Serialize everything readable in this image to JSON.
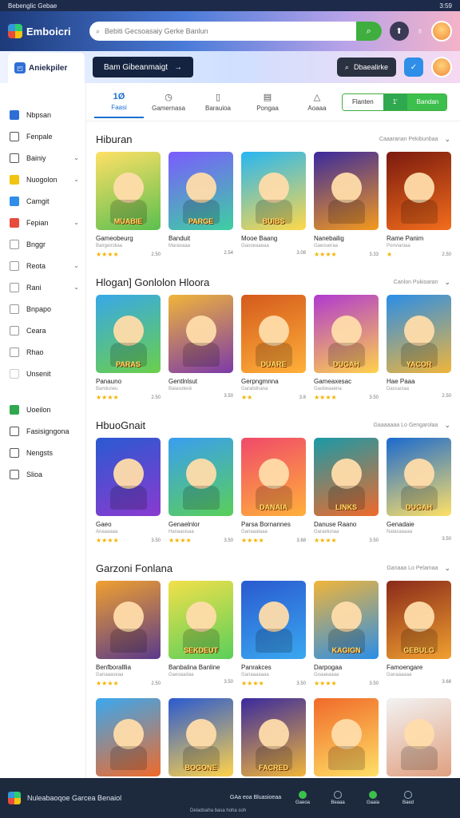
{
  "status": {
    "left": "Bebenglic Gebae",
    "right": "3:59"
  },
  "header": {
    "logo": "Emboicri",
    "search_placeholder": "Bebiti Gecsoasaiy Gerke Banlun"
  },
  "subbar": {
    "brand": "Aniekpiler",
    "promo": "Bam Gibeanmaigt",
    "btn": "Dbaealirke"
  },
  "sidebar": {
    "items": [
      {
        "label": "Nbpsan",
        "icon": "menu-icon",
        "color": "#2e6fd6"
      },
      {
        "label": "Fenpale",
        "icon": "home-icon",
        "color": "#555"
      },
      {
        "label": "Bainiy",
        "icon": "calendar-icon",
        "color": "#555",
        "chev": "⌄"
      },
      {
        "label": "Nuogolon",
        "icon": "coin-icon",
        "color": "#f1c40f",
        "chev": "⌄"
      },
      {
        "label": "Camgit",
        "icon": "chat-icon",
        "color": "#2e8ee8"
      },
      {
        "label": "Fepian",
        "icon": "game-icon",
        "color": "#e74c3c",
        "chev": "⌄"
      },
      {
        "label": "Bnggr",
        "icon": "box-icon",
        "color": "#999"
      },
      {
        "label": "Reota",
        "icon": "gear-icon",
        "color": "#999",
        "chev": "⌄"
      },
      {
        "label": "Rani",
        "icon": "tag-icon",
        "color": "#999",
        "chev": "⌄"
      },
      {
        "label": "Bnpapo",
        "icon": "grid-icon",
        "color": "#999"
      },
      {
        "label": "Ceara",
        "icon": "star-icon",
        "color": "#999"
      },
      {
        "label": "Rhao",
        "icon": "clock-icon",
        "color": "#999"
      },
      {
        "label": "Unsenit",
        "icon": "dot-icon",
        "color": "#fff"
      }
    ],
    "items2": [
      {
        "label": "Uoeilon",
        "icon": "clover-icon",
        "color": "#2fa84f"
      },
      {
        "label": "Fasisigngona",
        "icon": "cart-icon",
        "color": "#555"
      },
      {
        "label": "Nengsts",
        "icon": "bag-icon",
        "color": "#555"
      },
      {
        "label": "Slioa",
        "icon": "help-icon",
        "color": "#555"
      }
    ]
  },
  "tabs": [
    {
      "icon": "1Ø",
      "label": "Faasi"
    },
    {
      "icon": "◷",
      "label": "Gamernasa"
    },
    {
      "icon": "▯",
      "label": "Barauioa"
    },
    {
      "icon": "▤",
      "label": "Pongaa"
    },
    {
      "icon": "△",
      "label": "Aoaaa"
    }
  ],
  "filters": [
    "Flanten",
    "1'",
    "Bandan"
  ],
  "sections": [
    {
      "title": "Hiburan",
      "more": "Caaaranan Pekibunbaa",
      "cards": [
        {
          "name": "Gameobeurg",
          "sub": "Bairgeicdiaa",
          "stars": "★★★★",
          "score": "2.50",
          "bg": "linear-gradient(160deg,#ffe066,#5bbf4f)",
          "txt": "MUABIE"
        },
        {
          "name": "Banduit",
          "sub": "Maraoaaa",
          "stars": "",
          "score": "2.54",
          "bg": "linear-gradient(160deg,#7b5bff,#3ed0a0)",
          "txt": "PARGE"
        },
        {
          "name": "Mooe Baang",
          "sub": "Gaooeaaeaa",
          "stars": "",
          "score": "3.08",
          "bg": "linear-gradient(160deg,#27b6f2,#ffd84a)",
          "txt": "BUIBS"
        },
        {
          "name": "Nanebailig",
          "sub": "Gaeoueraa",
          "stars": "★★★★",
          "score": "3.33",
          "bg": "linear-gradient(160deg,#3a2a9e,#f59a1c)",
          "txt": ""
        },
        {
          "name": "Rame Panim",
          "sub": "Ponvianiaa",
          "stars": "★",
          "score": "2.50",
          "bg": "linear-gradient(160deg,#7a1a0e,#f36d1c)",
          "txt": ""
        }
      ]
    },
    {
      "title": "Hlogan] Gonlolon Hloora",
      "more": "Canlon Pukioaran",
      "cards": [
        {
          "name": "Panauno",
          "sub": "Banduneu",
          "stars": "★★★★",
          "score": "2.50",
          "bg": "linear-gradient(160deg,#38a8e8,#6bcf4a)",
          "txt": "PARAS"
        },
        {
          "name": "Gentlnlsut",
          "sub": "Balasoleuk",
          "stars": "",
          "score": "3.50",
          "bg": "linear-gradient(160deg,#f0b53a,#7c3aa8)",
          "txt": ""
        },
        {
          "name": "Gerpngmnna",
          "sub": "Garabdnana",
          "stars": "★★",
          "score": "3.8",
          "bg": "linear-gradient(160deg,#d45a1c,#ffb03a)",
          "txt": "DUARE"
        },
        {
          "name": "Gameaxesac",
          "sub": "Gaobeaaena",
          "stars": "★★★★",
          "score": "3.50",
          "bg": "linear-gradient(160deg,#b03ad0,#ffd24a)",
          "txt": "DUGAH"
        },
        {
          "name": "Hae Paaa",
          "sub": "Dassaciaa",
          "stars": "",
          "score": "2.50",
          "bg": "linear-gradient(160deg,#2a8ee8,#f0b53a)",
          "txt": "YACOR"
        }
      ]
    },
    {
      "title": "HbuoGnait",
      "more": "Gaaaaaaa Lo Gengarolaa",
      "cards": [
        {
          "name": "Gaeo",
          "sub": "Anaaaaaa",
          "stars": "★★★★",
          "score": "3.50",
          "bg": "linear-gradient(160deg,#2a5ad0,#8a3ad0)",
          "txt": ""
        },
        {
          "name": "Genaelnlor",
          "sub": "Hanaasisaa",
          "stars": "★★★★",
          "score": "3.50",
          "bg": "linear-gradient(160deg,#3a9ef0,#5acf5a)",
          "txt": ""
        },
        {
          "name": "Parsa Bornannes",
          "sub": "Ganaaalaaa",
          "stars": "★★★★",
          "score": "3.68",
          "bg": "linear-gradient(160deg,#f04a6a,#ffb03a)",
          "txt": "DANAIA"
        },
        {
          "name": "Danuse Raano",
          "sub": "Garaelunaa",
          "stars": "★★★★",
          "score": "3.50",
          "bg": "linear-gradient(160deg,#1a9aa8,#f06a2a)",
          "txt": "LINKS"
        },
        {
          "name": "Genadaie",
          "sub": "Nalasaaaaa",
          "stars": "",
          "score": "3.50",
          "bg": "linear-gradient(160deg,#1a6ad0,#ffe066)",
          "txt": "DUGAH"
        }
      ]
    },
    {
      "title": "Garzoni Fonlana",
      "more": "Ganaaa Lo Pelamaa",
      "cards": [
        {
          "name": "Benfboralllia",
          "sub": "Ganaaaseaa",
          "stars": "★★★★",
          "score": "2.50",
          "bg": "linear-gradient(160deg,#f0a030,#5a3a8a)",
          "txt": ""
        },
        {
          "name": "Banbalina Banline",
          "sub": "Gaeoaadaa",
          "stars": "",
          "score": "3.50",
          "bg": "linear-gradient(160deg,#f2e04a,#5acf5a)",
          "txt": "SEKDEUT"
        },
        {
          "name": "Panrakces",
          "sub": "Ganaaaaaaa",
          "stars": "★★★★",
          "score": "3.50",
          "bg": "linear-gradient(160deg,#2a5ad0,#3aa8f0)",
          "txt": ""
        },
        {
          "name": "Darpogaa",
          "sub": "Goaaeaaaa",
          "stars": "★★★★",
          "score": "3.50",
          "bg": "linear-gradient(160deg,#f0b53a,#2a8ee8)",
          "txt": "KAGIGN"
        },
        {
          "name": "Famoengare",
          "sub": "Ganaaaaaa",
          "stars": "",
          "score": "3.68",
          "bg": "linear-gradient(160deg,#8a2a1a,#f0a030)",
          "txt": "GEBULG"
        }
      ]
    },
    {
      "title": "",
      "more": "",
      "cards": [
        {
          "name": "",
          "sub": "",
          "stars": "",
          "score": "",
          "bg": "linear-gradient(160deg,#3aa8f0,#f06a2a)",
          "txt": ""
        },
        {
          "name": "",
          "sub": "",
          "stars": "",
          "score": "",
          "bg": "linear-gradient(160deg,#2a5ad0,#ffd24a)",
          "txt": "BOGONE"
        },
        {
          "name": "",
          "sub": "",
          "stars": "",
          "score": "",
          "bg": "linear-gradient(160deg,#3a2a9e,#f0b53a)",
          "txt": "FACRED"
        },
        {
          "name": "",
          "sub": "",
          "stars": "",
          "score": "",
          "bg": "linear-gradient(160deg,#f06a2a,#ffe066)",
          "txt": ""
        },
        {
          "name": "",
          "sub": "",
          "stars": "",
          "score": "",
          "bg": "linear-gradient(160deg,#f2f2f2,#e0a080)",
          "txt": ""
        }
      ]
    }
  ],
  "footer": {
    "left": "Nuleabaoqoe Garcea Benaiol",
    "mid": "GAa eoa Bluasioeaa",
    "tag": "Deladoaha basa hoha soh",
    "nav": [
      "Gaeoa",
      "Beaaa",
      "Gaaia",
      "Baed"
    ]
  }
}
